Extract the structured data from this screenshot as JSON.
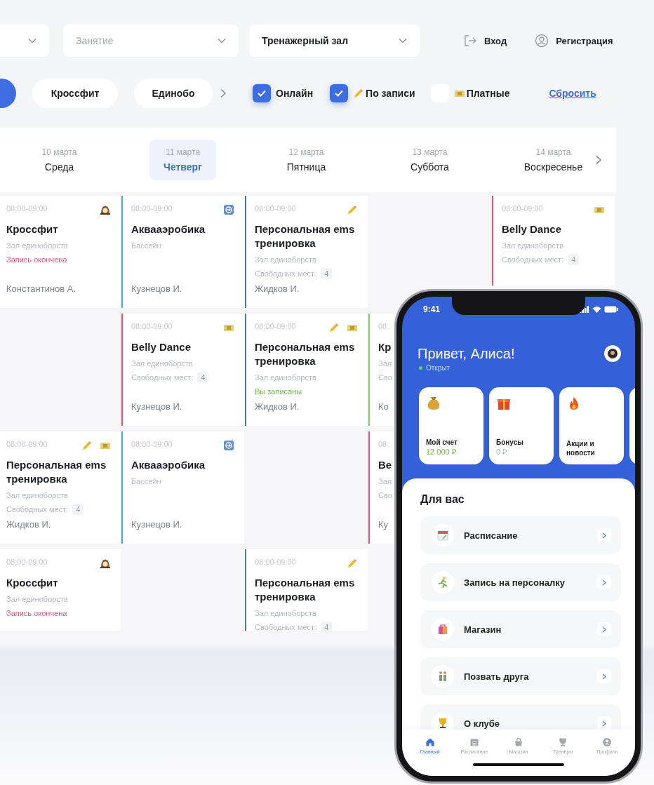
{
  "dropdowns": [
    {
      "placeholder": "Занятие"
    },
    {
      "value": "Тренажерный зал"
    }
  ],
  "auth": [
    {
      "label": "Вход",
      "kind": "login"
    },
    {
      "label": "Регистрация",
      "kind": "register"
    }
  ],
  "categories": [
    {
      "selected": true
    },
    {
      "label": "Кроссфит",
      "selected": false
    },
    {
      "label": "Единобо",
      "selected": false
    }
  ],
  "toggles": [
    {
      "kind": "online",
      "label": "Онлайн",
      "checked": true
    },
    {
      "kind": "booking",
      "label": "По записи",
      "checked": true
    },
    {
      "kind": "paid",
      "label": "Платные",
      "checked": false
    }
  ],
  "reset_link": "Сбросить",
  "days": [
    {
      "date": "10 марта",
      "weekday": "Среда",
      "selected": false
    },
    {
      "date": "11 марта",
      "weekday": "Четверг",
      "selected": true
    },
    {
      "date": "12 марта",
      "weekday": "Пятница",
      "selected": false
    },
    {
      "date": "13 марта",
      "weekday": "Суббота",
      "selected": false
    },
    {
      "date": "14 марта",
      "weekday": "Воскресенье",
      "selected": false
    }
  ],
  "schedule": [
    [
      {
        "kind": "class",
        "time": "08:00-09:00",
        "title": "Кроссфит",
        "room": "Зал единоборств",
        "status": {
          "kind": "ended",
          "text": "Запись окончена"
        },
        "trainer": "Константинов А.",
        "online": false,
        "by_booking": false,
        "paid": false
      },
      {
        "kind": "class",
        "time": "08:00-09:00",
        "title": "Аквааэробика",
        "room": "Бассейн",
        "trainer": "Кузнецов И.",
        "color": "#3bb3dc",
        "online": true,
        "by_booking": false,
        "paid": false
      },
      {
        "kind": "class",
        "time": "08:00-09:00",
        "title": "Персональная ems тренировка",
        "room": "Зал единоборств",
        "status": {
          "kind": "seats",
          "text": "Свободных мест:",
          "count": "4"
        },
        "trainer": "Жидков И.",
        "color": "#4d6fe0",
        "online": false,
        "by_booking": true,
        "paid": false
      },
      {
        "kind": "empty"
      },
      {
        "kind": "class",
        "time": "08:00-09:00",
        "title": "Belly Dance",
        "room": "Зал единоборств",
        "status": {
          "kind": "seats",
          "text": "Свободных мест:",
          "count": "4"
        },
        "color": "#f0527e",
        "online": false,
        "by_booking": false,
        "paid": true
      }
    ],
    [
      {
        "kind": "empty"
      },
      {
        "kind": "class",
        "time": "08:00-09:00",
        "title": "Belly Dance",
        "room": "Зал единоборств",
        "status": {
          "kind": "seats",
          "text": "Свободных мест:",
          "count": "4"
        },
        "trainer": "Кузнецов И.",
        "color": "#f0527e",
        "online": false,
        "by_booking": false,
        "paid": true
      },
      {
        "kind": "class",
        "time": "08:00-09:00",
        "title": "Персональная ems тренировка",
        "room": "Зал единоборств",
        "status": {
          "kind": "booked",
          "text": "Вы записаны"
        },
        "trainer": "Жидков И.",
        "color": "#4d6fe0",
        "online": false,
        "by_booking": true,
        "paid": true
      },
      {
        "kind": "class",
        "time": "08:",
        "title": "Кр",
        "room": "Зал",
        "status": {
          "kind": "seats",
          "text": "Сво"
        },
        "trainer": "Ко",
        "color": "#7cd04a",
        "online": false,
        "by_booking": false,
        "paid": false
      }
    ],
    [
      {
        "kind": "class",
        "time": "08:00-09:00",
        "title": "Персональная ems тренировка",
        "room": "Зал единоборств",
        "status": {
          "kind": "seats",
          "text": "Свободных мест:",
          "count": "4"
        },
        "trainer": "Жидков И.",
        "online": false,
        "by_booking": true,
        "paid": true
      },
      {
        "kind": "class",
        "time": "08:00-09:00",
        "title": "Аквааэробика",
        "room": "Бассейн",
        "trainer": "Кузнецов И.",
        "color": "#3bb3dc",
        "online": true,
        "by_booking": false,
        "paid": false
      },
      {
        "kind": "empty"
      },
      {
        "kind": "class",
        "time": "08:",
        "title": "Be",
        "room": "Зал",
        "status": {
          "kind": "seats",
          "text": "Сво"
        },
        "trainer": "Ку",
        "color": "#f0527e",
        "online": false,
        "by_booking": false,
        "paid": false
      }
    ],
    [
      {
        "kind": "class",
        "time": "08:00-09:00",
        "title": "Кроссфит",
        "room": "Зал единоборств",
        "status": {
          "kind": "ended",
          "text": "Запись окончена"
        },
        "online": false,
        "by_booking": false,
        "paid": false
      },
      {
        "kind": "empty"
      },
      {
        "kind": "class",
        "time": "08:00-09:00",
        "title": "Персональная ems тренировка",
        "room": "Зал единоборств",
        "status": {
          "kind": "seats",
          "text": "Свободных мест:",
          "count": "4"
        },
        "color": "#4d6fe0",
        "online": false,
        "by_booking": true,
        "paid": false
      },
      {
        "kind": "empty"
      }
    ]
  ],
  "phone": {
    "time": "9:41",
    "greeting": "Привет, Алиса!",
    "status": "Открыт",
    "tiles": [
      {
        "kind": "balance",
        "title": "Мой счет",
        "value": "12 000 ₽"
      },
      {
        "kind": "bonus",
        "title": "Бонусы",
        "value": "0 ₽"
      },
      {
        "kind": "promo",
        "title": "Акции и новости"
      }
    ],
    "section": "Для вас",
    "menu": [
      {
        "label": "Расписание"
      },
      {
        "label": "Запись на персоналку"
      },
      {
        "label": "Магазин"
      },
      {
        "label": "Позвать друга"
      },
      {
        "label": "О клубе"
      }
    ],
    "tabs": [
      {
        "label": "Главный",
        "selected": true
      },
      {
        "label": "Расписание",
        "selected": false
      },
      {
        "label": "Магазин",
        "selected": false
      },
      {
        "label": "Тренеры",
        "selected": false
      },
      {
        "label": "Профиль",
        "selected": false
      }
    ]
  }
}
